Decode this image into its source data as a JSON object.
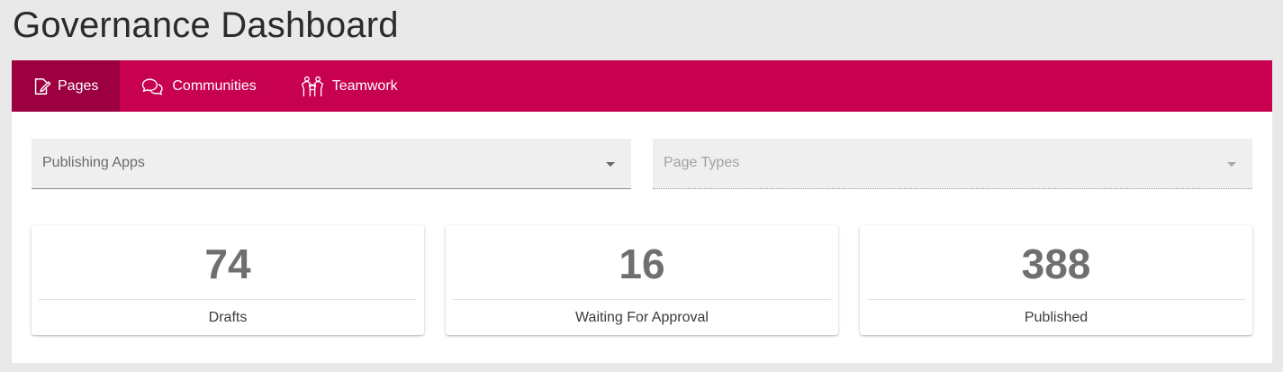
{
  "header": {
    "title": "Governance Dashboard"
  },
  "tabs": [
    {
      "label": "Pages",
      "icon": "edit-page-icon",
      "active": true
    },
    {
      "label": "Communities",
      "icon": "chat-bubbles-icon",
      "active": false
    },
    {
      "label": "Teamwork",
      "icon": "people-icon",
      "active": false
    }
  ],
  "filters": {
    "publishing_apps": {
      "placeholder": "Publishing Apps"
    },
    "page_types": {
      "placeholder": "Page Types",
      "disabled": true
    }
  },
  "stats": [
    {
      "value": "74",
      "label": "Drafts"
    },
    {
      "value": "16",
      "label": "Waiting For Approval"
    },
    {
      "value": "388",
      "label": "Published"
    }
  ],
  "colors": {
    "tabbar": "#c80050",
    "tab_active": "#9c0041",
    "background": "#e9e9e9",
    "stat_value": "#6f6f6f"
  }
}
